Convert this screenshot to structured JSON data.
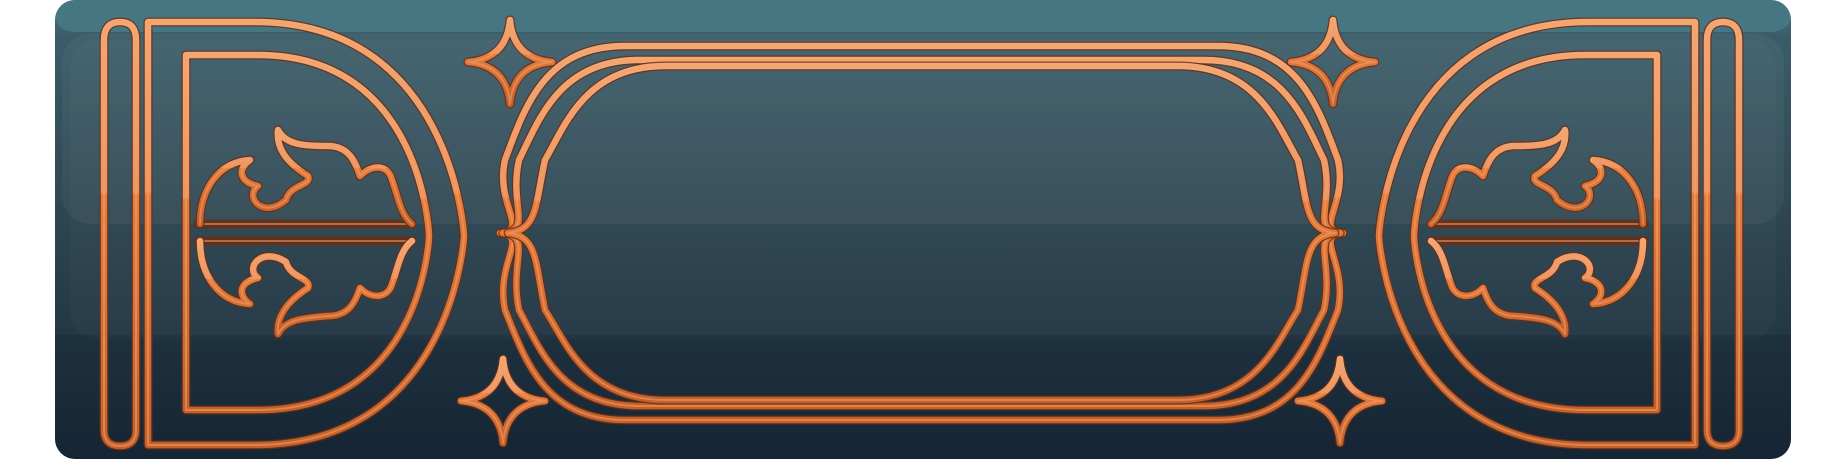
{
  "panel": {
    "kind": "ornate-banner-frame",
    "has_text": false,
    "colors": {
      "panel_top": "#467682",
      "panel_mid": "#2f4854",
      "panel_bottom": "#1a2b3b",
      "ornament_light": "#f0a070",
      "ornament_mid": "#e07838",
      "ornament_dark": "#a84c22",
      "ornament_outline": "#6a2e14"
    },
    "icons": {
      "sparkles": "four-point-star-icon",
      "leaves": "fleur-leaf-icon",
      "caps": "half-round-cap-icon",
      "pillars": "rounded-pillar-icon"
    }
  }
}
